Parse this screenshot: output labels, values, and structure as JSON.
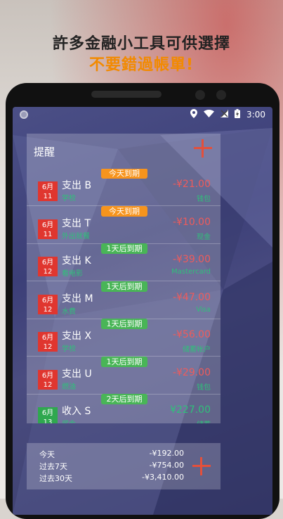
{
  "promo": {
    "line1": "許多金融小工具可供選擇",
    "line2": "不要錯過帳單!"
  },
  "status": {
    "time": "3:00"
  },
  "panel": {
    "title": "提醒"
  },
  "reminders": [
    {
      "month": "6月",
      "day": "11",
      "title": "支出 B",
      "sub": "学校",
      "amount": "-¥21.00",
      "account": "钱包",
      "badge": "今天到期",
      "badge_color": "orange",
      "cal_color": "red",
      "amount_color": "red"
    },
    {
      "month": "6月",
      "day": "11",
      "title": "支出 T",
      "sub": "外出就餐",
      "amount": "-¥10.00",
      "account": "现金",
      "badge": "今天到期",
      "badge_color": "orange",
      "cal_color": "red",
      "amount_color": "red"
    },
    {
      "month": "6月",
      "day": "12",
      "title": "支出 K",
      "sub": "看电影",
      "amount": "-¥39.00",
      "account": "Mastercard",
      "badge": "1天后到期",
      "badge_color": "green",
      "cal_color": "red",
      "amount_color": "red"
    },
    {
      "month": "6月",
      "day": "12",
      "title": "支出 M",
      "sub": "水费",
      "amount": "-¥47.00",
      "account": "Visa",
      "badge": "1天后到期",
      "badge_color": "green",
      "cal_color": "red",
      "amount_color": "red"
    },
    {
      "month": "6月",
      "day": "12",
      "title": "支出 X",
      "sub": "学校",
      "amount": "-¥56.00",
      "account": "储蓄帐户",
      "badge": "1天后到期",
      "badge_color": "green",
      "cal_color": "red",
      "amount_color": "red"
    },
    {
      "month": "6月",
      "day": "12",
      "title": "支出 U",
      "sub": "燃油",
      "amount": "-¥29.00",
      "account": "钱包",
      "badge": "1天后到期",
      "badge_color": "green",
      "cal_color": "red",
      "amount_color": "red"
    },
    {
      "month": "6月",
      "day": "13",
      "title": "收入 S",
      "sub": "奖金",
      "amount": "¥227.00",
      "account": "储蓄",
      "badge": "2天后到期",
      "badge_color": "green",
      "cal_color": "green",
      "amount_color": "green"
    }
  ],
  "summary": [
    {
      "label": "今天",
      "value": "-¥192.00"
    },
    {
      "label": "过去7天",
      "value": "-¥754.00"
    },
    {
      "label": "过去30天",
      "value": "-¥3,410.00"
    }
  ],
  "icons": {
    "add": "plus-icon",
    "location": "location-icon",
    "wifi": "wifi-icon",
    "signal": "signal-icon",
    "battery": "battery-icon"
  }
}
